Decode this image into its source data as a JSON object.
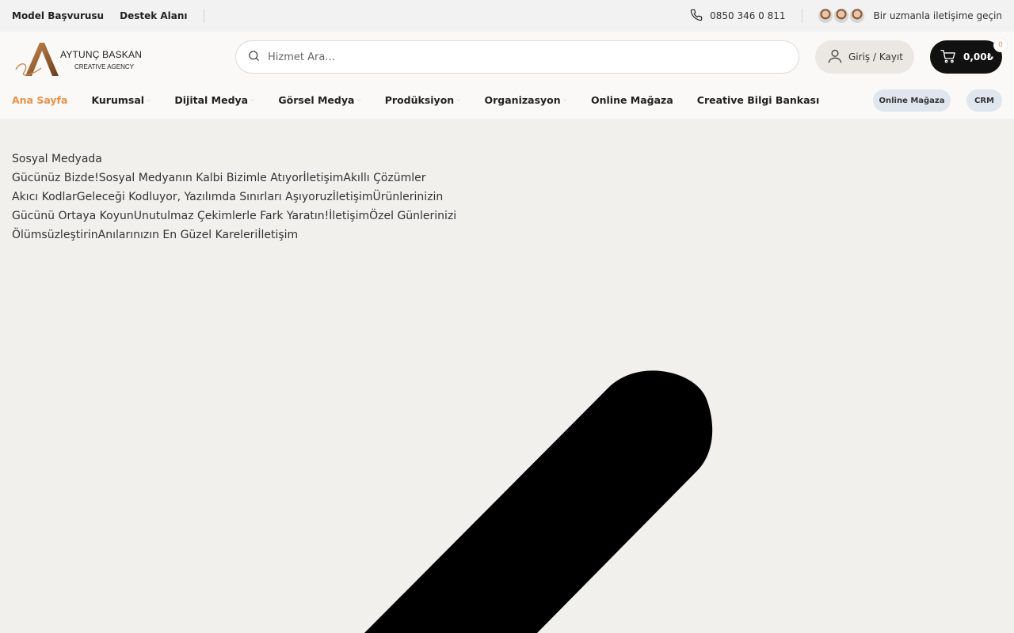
{
  "topbar": {
    "links": [
      "Model Başvurusu",
      "Destek Alanı"
    ],
    "phone": "0850 346 0 811",
    "expert_cta": "Bir uzmanla iletişime geçin"
  },
  "header": {
    "logo_brand": "AYTUNÇ BASKAN",
    "logo_sub": "CREATIVE AGENCY",
    "logo_script": "Creative",
    "search_placeholder": "Hizmet Ara...",
    "login_label": "Giriş / Kayıt",
    "cart_total": "0,00₺",
    "cart_count": "0"
  },
  "nav": {
    "items": [
      {
        "label": "Ana Sayfa",
        "active": true,
        "dropdown": false
      },
      {
        "label": "Kurumsal",
        "active": false,
        "dropdown": true
      },
      {
        "label": "Dijital Medya",
        "active": false,
        "dropdown": true
      },
      {
        "label": "Görsel Medya",
        "active": false,
        "dropdown": true
      },
      {
        "label": "Prodüksiyon",
        "active": false,
        "dropdown": true
      },
      {
        "label": "Organizasyon",
        "active": false,
        "dropdown": true
      },
      {
        "label": "Online Mağaza",
        "active": false,
        "dropdown": false
      },
      {
        "label": "Creative Bilgi Bankası",
        "active": false,
        "dropdown": false
      }
    ],
    "pills": [
      "Online Mağaza",
      "CRM"
    ]
  },
  "hero": {
    "lines": [
      "Sosyal Medyada",
      "Gücünüz Bizde!Sosyal Medyanın Kalbi Bizimle AtıyorİletişimAkıllı Çözümler",
      "Akıcı KodlarGeleceği Kodluyor, Yazılımda Sınırları AşıyoruzİletişimÜrünlerinizin",
      "Gücünü Ortaya KoyunUnutulmaz Çekimlerle Fark Yaratın!İletişimÖzel Günlerinizi",
      "ÖlümsüzleştirinAnılarınızın En Güzel Kareleriİletişim"
    ]
  },
  "colors": {
    "accent": "#e8914a",
    "background": "#f2f0ec",
    "topbar": "#f2f2f2",
    "cart_bg": "#111111",
    "pill_bg": "#dfe6ee"
  },
  "icons": [
    "phone-icon",
    "search-icon",
    "user-icon",
    "cart-icon",
    "chevron-down-icon"
  ]
}
